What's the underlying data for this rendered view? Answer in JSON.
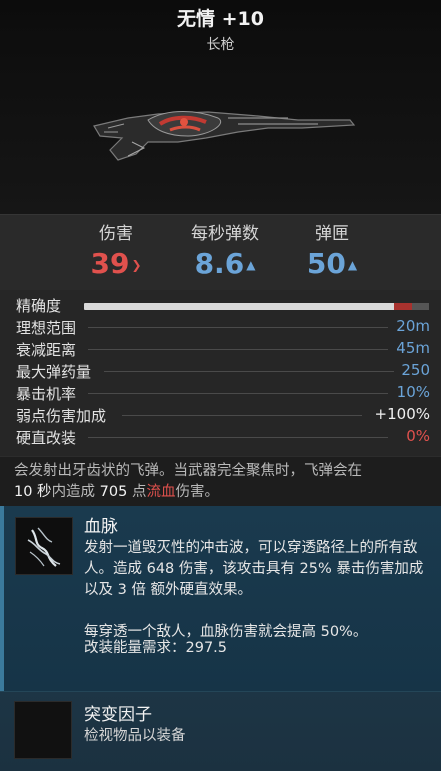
{
  "weapon": {
    "name": "无情 +10",
    "type": "长枪"
  },
  "main_stats": [
    {
      "label": "伤害",
      "value": "39",
      "trend": "down",
      "color": "#e0514d"
    },
    {
      "label": "每秒弹数",
      "value": "8.6",
      "trend": "up",
      "color": "#6ba4d8"
    },
    {
      "label": "弹匣",
      "value": "50",
      "trend": "up",
      "color": "#6ba4d8"
    }
  ],
  "detail_stats": {
    "accuracy_label": "精确度",
    "accuracy_level": 0.9,
    "rows": [
      {
        "label": "理想范围",
        "value": "20m",
        "color": "blue"
      },
      {
        "label": "衰减距离",
        "value": "45m",
        "color": "blue"
      },
      {
        "label": "最大弹药量",
        "value": "250",
        "color": "blue"
      },
      {
        "label": "暴击机率",
        "value": "10%",
        "color": "blue"
      },
      {
        "label": "弱点伤害加成",
        "value": "+100%",
        "color": "white"
      },
      {
        "label": "硬直改装",
        "value": "0%",
        "color": "red"
      }
    ]
  },
  "description": {
    "line1": "会发射出牙齿状的飞弹。当武器完全聚焦时，飞弹会在",
    "seconds": "10 秒",
    "mid1": "内造成",
    "damage": "705",
    "mid2": "点",
    "bleed": "流血",
    "end": "伤害。"
  },
  "mod": {
    "name": "血脉",
    "text1": "发射一道毁灭性的冲击波，可以穿透路径上的所有敌人。造成 648 伤害，该攻击具有 25% 暴击伤害加成以及 3 倍 额外硬直效果。",
    "text2": "每穿透一个敌人，血脉伤害就会提高 50%。",
    "cost": "改装能量需求：297.5"
  },
  "mutator": {
    "name": "突变因子",
    "hint": "检视物品以装备"
  },
  "colors": {
    "negative": "#e0514d",
    "positive": "#6ba4d8",
    "mod_panel": "#1a3a4e"
  }
}
